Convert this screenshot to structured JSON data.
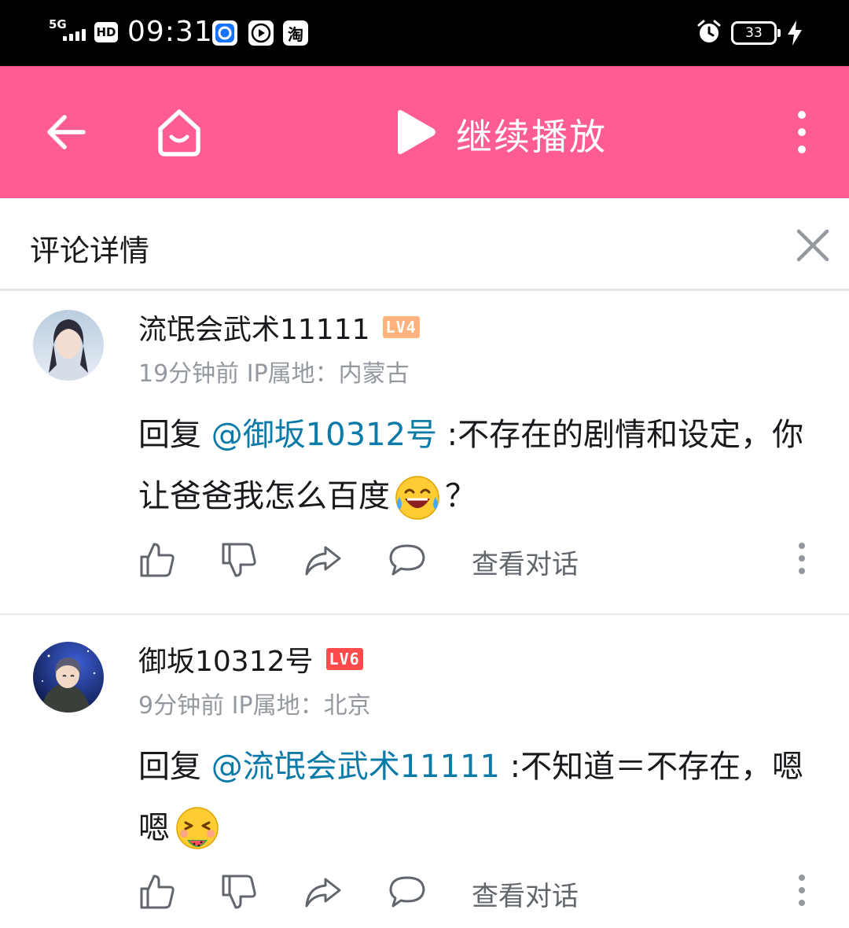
{
  "status_bar": {
    "network": "5G",
    "hd": "HD",
    "time": "09:31",
    "battery": "33",
    "icons": [
      "signal-icon",
      "hd-icon",
      "app-icon",
      "video-app-icon",
      "taobao-icon",
      "alarm-icon",
      "battery-icon",
      "charging-icon"
    ],
    "taobao_label": "淘"
  },
  "header": {
    "title": "继续播放",
    "icons": [
      "back-arrow-icon",
      "home-icon",
      "play-icon",
      "more-vertical-icon"
    ],
    "bg_color": "#ff5c96"
  },
  "panel": {
    "title": "评论详情"
  },
  "comments": [
    {
      "username": "流氓会武术11111",
      "level": "LV4",
      "level_color": "#ffb37c",
      "time": "19分钟前",
      "ip": "IP属地：内蒙古",
      "reply_prefix": "回复 ",
      "mention": "@御坂10312号",
      "text_1": " :不存在的剧情和设定，你让爸爸我怎么百度",
      "emoji": "laughing-crying-emoji",
      "text_2": "？",
      "view_dialog": "查看对话"
    },
    {
      "username": "御坂10312号",
      "level": "LV6",
      "level_color": "#ff4b4b",
      "time": "9分钟前",
      "ip": "IP属地：北京",
      "reply_prefix": "回复 ",
      "mention": "@流氓会武术11111",
      "text_1": " :不知道＝不存在，嗯嗯",
      "emoji": "eating-watermelon-emoji",
      "text_2": "",
      "view_dialog": "查看对话"
    }
  ]
}
